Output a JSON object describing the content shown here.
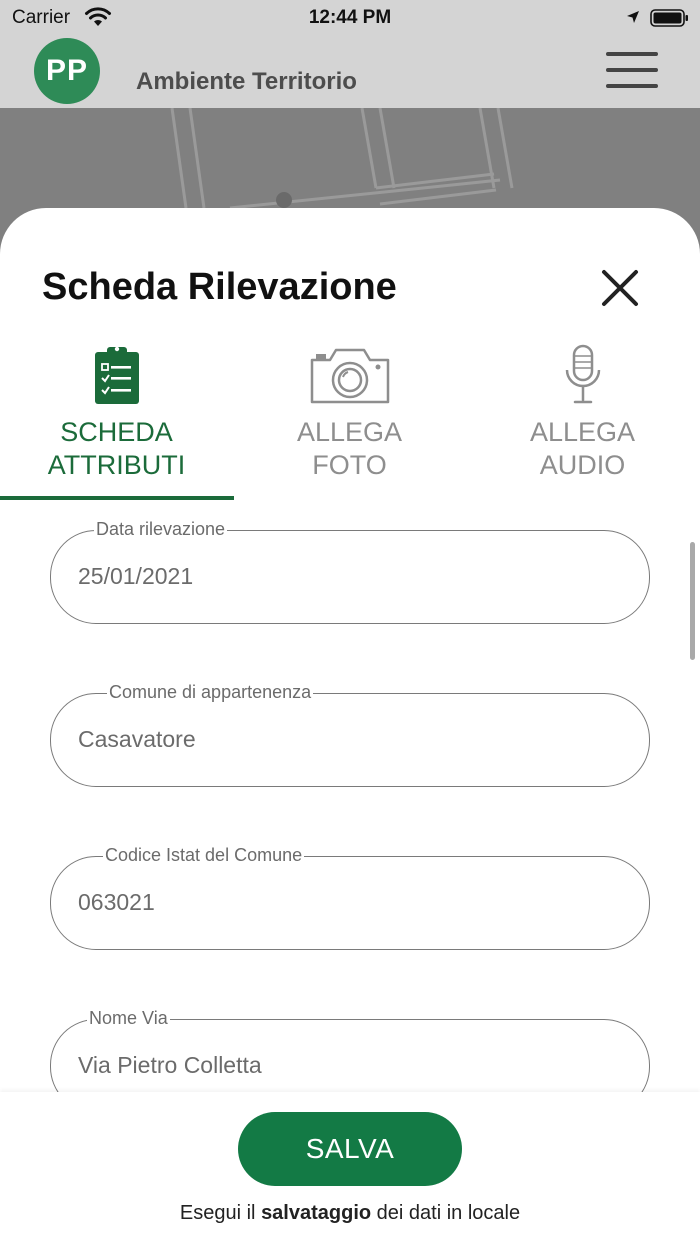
{
  "status_bar": {
    "carrier": "Carrier",
    "time": "12:44 PM",
    "icons": [
      "wifi-icon",
      "location-arrow-icon",
      "battery-icon"
    ]
  },
  "header": {
    "avatar_initials": "PP",
    "title": "Ambiente Territorio",
    "menu_icon": "hamburger-menu-icon"
  },
  "colors": {
    "brand_green": "#137a45",
    "active_tab_green": "#1b6b3a",
    "avatar_green": "#2e8b57",
    "header_gray": "#d4d4d4",
    "map_gray": "#808080"
  },
  "sheet": {
    "title": "Scheda Rilevazione",
    "close_icon": "close-icon",
    "tabs": [
      {
        "line1": "SCHEDA",
        "line2": "ATTRIBUTI",
        "icon": "clipboard-checklist-icon",
        "active": true
      },
      {
        "line1": "ALLEGA",
        "line2": "FOTO",
        "icon": "camera-icon",
        "active": false
      },
      {
        "line1": "ALLEGA",
        "line2": "AUDIO",
        "icon": "microphone-icon",
        "active": false
      }
    ],
    "fields": [
      {
        "label": "Data rilevazione",
        "value": "25/01/2021"
      },
      {
        "label": "Comune di appartenenza",
        "value": "Casavatore"
      },
      {
        "label": "Codice Istat del Comune",
        "value": "063021"
      },
      {
        "label": "Nome Via",
        "value": "Via Pietro Colletta"
      }
    ]
  },
  "footer": {
    "save_label": "SALVA",
    "note_prefix": "Esegui il ",
    "note_bold": "salvataggio",
    "note_suffix": " dei dati in locale"
  }
}
